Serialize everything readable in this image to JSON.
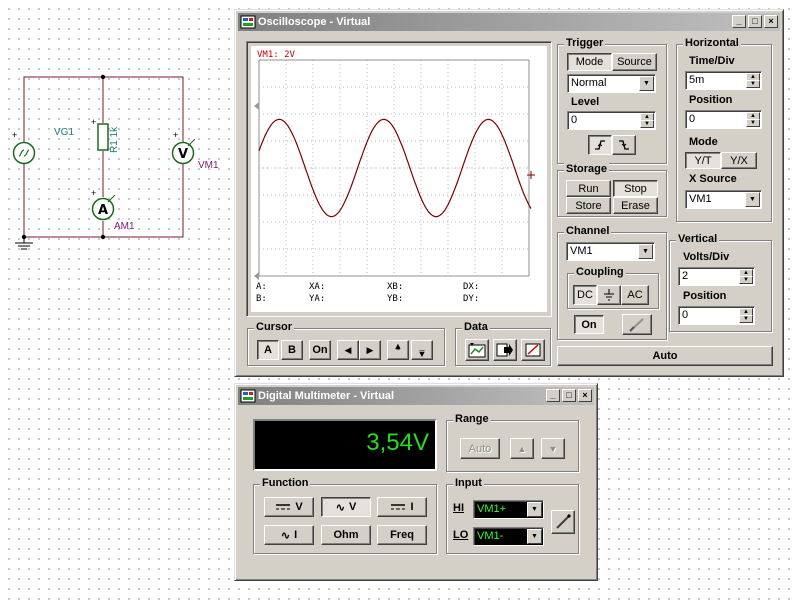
{
  "schematic": {
    "source_label": "VG1",
    "resistor_label": "R1 1k",
    "voltmeter_label": "VM1",
    "ammeter_label": "AM1",
    "plus": "+"
  },
  "oscilloscope": {
    "title": "Oscilloscope - Virtual",
    "screen_label": "VM1: 2V",
    "readouts": {
      "a": "A:",
      "b": "B:",
      "xa": "XA:",
      "ya": "YA:",
      "xb": "XB:",
      "yb": "YB:",
      "dx": "DX:",
      "dy": "DY:"
    },
    "trigger": {
      "title": "Trigger",
      "mode_label": "Mode",
      "source_label": "Source",
      "mode_value": "Normal",
      "level_label": "Level",
      "level_value": "0"
    },
    "horizontal": {
      "title": "Horizontal",
      "time_div_label": "Time/Div",
      "time_div_value": "5m",
      "position_label": "Position",
      "position_value": "0",
      "mode_label": "Mode",
      "yt_label": "Y/T",
      "yx_label": "Y/X",
      "xsource_label": "X Source",
      "xsource_value": "VM1"
    },
    "storage": {
      "title": "Storage",
      "run_label": "Run",
      "stop_label": "Stop",
      "store_label": "Store",
      "erase_label": "Erase"
    },
    "channel": {
      "title": "Channel",
      "value": "VM1",
      "coupling_title": "Coupling",
      "dc_label": "DC",
      "ac_label": "AC",
      "on_label": "On"
    },
    "vertical": {
      "title": "Vertical",
      "volts_div_label": "Volts/Div",
      "volts_div_value": "2",
      "position_label": "Position",
      "position_value": "0"
    },
    "cursor": {
      "title": "Cursor",
      "a_label": "A",
      "b_label": "B",
      "on_label": "On"
    },
    "data": {
      "title": "Data"
    },
    "auto_label": "Auto",
    "trace": {
      "color": "#800000",
      "amplitude_div": 1.8,
      "cycles_visible": 2.6
    }
  },
  "multimeter": {
    "title": "Digital Multimeter - Virtual",
    "display_value": "3,54V",
    "range": {
      "title": "Range",
      "auto_label": "Auto"
    },
    "function": {
      "title": "Function",
      "dcv_label": "V",
      "acv_label": "V",
      "dci_label": "I",
      "aci_label": "I",
      "ohm_label": "Ohm",
      "freq_label": "Freq"
    },
    "input": {
      "title": "Input",
      "hi_label": "HI",
      "lo_label": "LO",
      "hi_value": "VM1+",
      "lo_value": "VM1-"
    }
  }
}
